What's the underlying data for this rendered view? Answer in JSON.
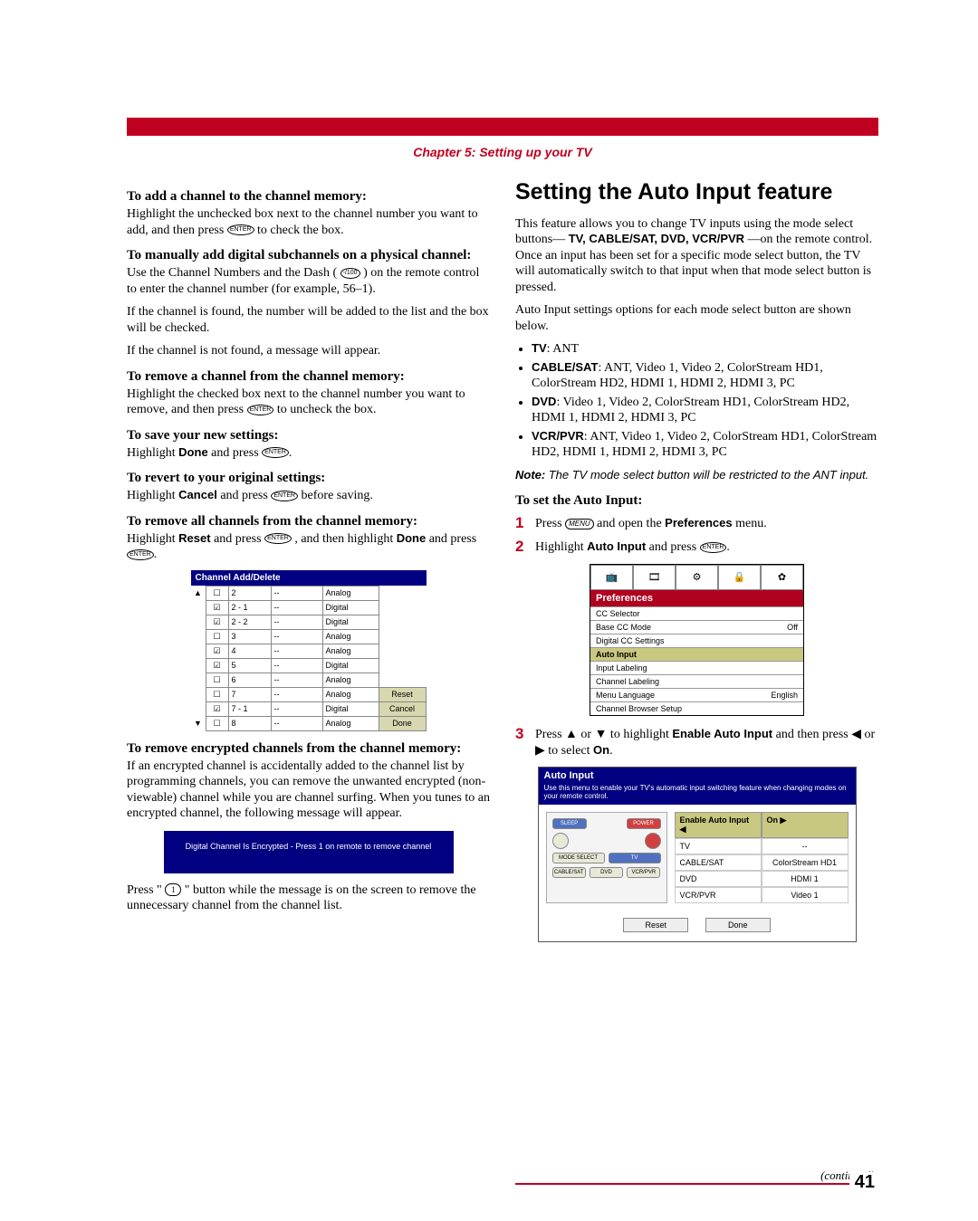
{
  "chapter": "Chapter 5: Setting up your TV",
  "left": {
    "h1": "To add a channel to the channel memory:",
    "p1a": "Highlight the unchecked box next to the channel number you want to add, and then press ",
    "p1b": " to check the box.",
    "h2": "To manually add digital subchannels on a physical channel:",
    "p2a": "Use the Channel Numbers and the Dash (",
    "p2b": ") on the remote control to enter the channel number (for example, 56–1).",
    "p3": "If the channel is found, the number will be added to the list and the box will be checked.",
    "p4": "If the channel is not found, a message will appear.",
    "h3": "To remove a channel from the channel memory:",
    "p5a": "Highlight the checked box next to the channel number you want to remove, and then press ",
    "p5b": " to uncheck the box.",
    "h4": "To save your new settings:",
    "p6a": "Highlight ",
    "p6b": "Done",
    "p6c": " and press ",
    "h5": "To revert to your original settings:",
    "p7a": "Highlight ",
    "p7b": "Cancel",
    "p7c": " and press ",
    "p7d": " before saving.",
    "h6": "To remove all channels from the channel memory:",
    "p8a": "Highlight ",
    "p8b": "Reset",
    "p8c": " and press ",
    "p8d": ", and then highlight ",
    "p8e": "Done",
    "p8f": " and press ",
    "channel_header": "Channel Add/Delete",
    "rows": [
      {
        "a": "▲",
        "chk": "☐",
        "num": "2",
        "dash": "--",
        "type": "Analog",
        "btn": ""
      },
      {
        "a": "",
        "chk": "☑",
        "num": "2 - 1",
        "dash": "--",
        "type": "Digital",
        "btn": ""
      },
      {
        "a": "",
        "chk": "☑",
        "num": "2 - 2",
        "dash": "--",
        "type": "Digital",
        "btn": ""
      },
      {
        "a": "",
        "chk": "☐",
        "num": "3",
        "dash": "--",
        "type": "Analog",
        "btn": ""
      },
      {
        "a": "",
        "chk": "☑",
        "num": "4",
        "dash": "--",
        "type": "Analog",
        "btn": ""
      },
      {
        "a": "",
        "chk": "☑",
        "num": "5",
        "dash": "--",
        "type": "Digital",
        "btn": ""
      },
      {
        "a": "",
        "chk": "☐",
        "num": "6",
        "dash": "--",
        "type": "Analog",
        "btn": ""
      },
      {
        "a": "",
        "chk": "☐",
        "num": "7",
        "dash": "--",
        "type": "Analog",
        "btn": "Reset"
      },
      {
        "a": "",
        "chk": "☑",
        "num": "7 - 1",
        "dash": "--",
        "type": "Digital",
        "btn": "Cancel"
      },
      {
        "a": "▼",
        "chk": "☐",
        "num": "8",
        "dash": "--",
        "type": "Analog",
        "btn": "Done"
      }
    ],
    "h7": "To remove encrypted channels from the channel memory:",
    "p9": "If an encrypted channel is accidentally added to the channel list by programming channels, you can remove the unwanted encrypted (non-viewable) channel while you are channel surfing. When you tunes to an encrypted channel, the following message will appear.",
    "banner": "Digital Channel Is Encrypted - Press 1 on remote to remove channel",
    "p10a": "Press \"",
    "p10b": "\" button while the message is on the screen to remove the unnecessary channel from the channel list."
  },
  "right": {
    "title": "Setting the Auto Input feature",
    "p1a": "This feature allows you to change TV inputs using the mode select buttons—",
    "p1b": "TV, CABLE/SAT, DVD, VCR/PVR",
    "p1c": "—on the remote control. Once an input has been set for a specific mode select button, the TV will automatically switch to that input when that mode select button is pressed.",
    "p2": "Auto Input settings options for each mode select button are shown below.",
    "bul": [
      {
        "a": "TV",
        "b": ": ANT"
      },
      {
        "a": "CABLE/SAT",
        "b": ": ANT, Video 1, Video 2, ColorStream HD1, ColorStream HD2, HDMI 1, HDMI 2, HDMI 3, PC"
      },
      {
        "a": "DVD",
        "b": ": Video 1, Video 2, ColorStream HD1, ColorStream HD2, HDMI 1, HDMI 2, HDMI 3, PC"
      },
      {
        "a": "VCR/PVR",
        "b": ": ANT, Video 1, Video 2, ColorStream HD1, ColorStream HD2, HDMI 1, HDMI 2, HDMI 3, PC"
      }
    ],
    "note_label": "Note:",
    "note_text": " The TV mode select button will be restricted to the ANT input.",
    "h_set": "To set the Auto Input:",
    "step1a": "Press ",
    "step1b": " and open the ",
    "step1c": "Preferences",
    "step1d": " menu.",
    "step2a": "Highlight ",
    "step2b": "Auto Input",
    "step2c": " and press ",
    "pref_title": "Preferences",
    "pref_rows": [
      {
        "l": "CC Selector",
        "r": ""
      },
      {
        "l": "Base CC Mode",
        "r": "Off"
      },
      {
        "l": "Digital CC Settings",
        "r": ""
      },
      {
        "l": "Auto Input",
        "r": "",
        "hl": true
      },
      {
        "l": "Input Labeling",
        "r": ""
      },
      {
        "l": "Channel Labeling",
        "r": ""
      },
      {
        "l": "Menu Language",
        "r": "English"
      },
      {
        "l": "Channel Browser Setup",
        "r": ""
      }
    ],
    "step3a": "Press ▲ or ▼ to highlight ",
    "step3b": "Enable Auto Input",
    "step3c": " and then press ◀ or ▶ to select ",
    "step3d": "On",
    "auto_title": "Auto Input",
    "auto_desc": "Use this menu to enable your TV's automatic input switching feature when changing modes on your remote control.",
    "remote": {
      "sleep": "SLEEP",
      "power": "POWER",
      "mode": "MODE SELECT",
      "tv": "TV",
      "cbl": "CABLE/SAT",
      "dvd": "DVD",
      "vcr": "VCR/PVR"
    },
    "auto_head_l": "Enable Auto Input ◀",
    "auto_head_r": "On             ▶",
    "auto_rows": [
      {
        "l": "TV",
        "r": "--"
      },
      {
        "l": "CABLE/SAT",
        "r": "ColorStream HD1"
      },
      {
        "l": "DVD",
        "r": "HDMI 1"
      },
      {
        "l": "VCR/PVR",
        "r": "Video 1"
      }
    ],
    "reset": "Reset",
    "done": "Done"
  },
  "continued": "(continued)",
  "page": "41",
  "icons": {
    "enter": "ENTER",
    "dash": "-/100",
    "menu": "MENU",
    "one": "1"
  }
}
